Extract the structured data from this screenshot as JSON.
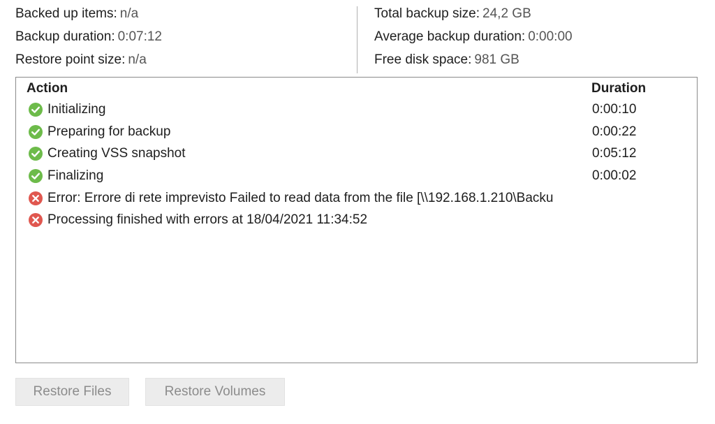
{
  "stats": {
    "left": [
      {
        "label": "Backed up items:",
        "value": "n/a"
      },
      {
        "label": "Backup duration:",
        "value": "0:07:12"
      },
      {
        "label": "Restore point size:",
        "value": "n/a"
      }
    ],
    "right": [
      {
        "label": "Total backup size:",
        "value": "24,2 GB"
      },
      {
        "label": "Average backup duration:",
        "value": "0:00:00"
      },
      {
        "label": "Free disk space:",
        "value": "981 GB"
      }
    ]
  },
  "log": {
    "headers": {
      "action": "Action",
      "duration": "Duration"
    },
    "rows": [
      {
        "status": "success",
        "text": "Initializing",
        "duration": "0:00:10"
      },
      {
        "status": "success",
        "text": "Preparing for backup",
        "duration": "0:00:22"
      },
      {
        "status": "success",
        "text": "Creating VSS snapshot",
        "duration": "0:05:12"
      },
      {
        "status": "success",
        "text": "Finalizing",
        "duration": "0:00:02"
      },
      {
        "status": "error",
        "text": "Error: Errore di rete imprevisto Failed to read data from the file [\\\\192.168.1.210\\Backu",
        "duration": ""
      },
      {
        "status": "error",
        "text": "Processing finished with errors at 18/04/2021 11:34:52",
        "duration": ""
      }
    ]
  },
  "buttons": {
    "restore_files": "Restore Files",
    "restore_volumes": "Restore Volumes"
  },
  "colors": {
    "success": "#6dbb4a",
    "error": "#e0574f",
    "disabled_text": "#8c8c8c"
  },
  "icons": {
    "success": "check-circle-icon",
    "error": "x-circle-icon"
  }
}
